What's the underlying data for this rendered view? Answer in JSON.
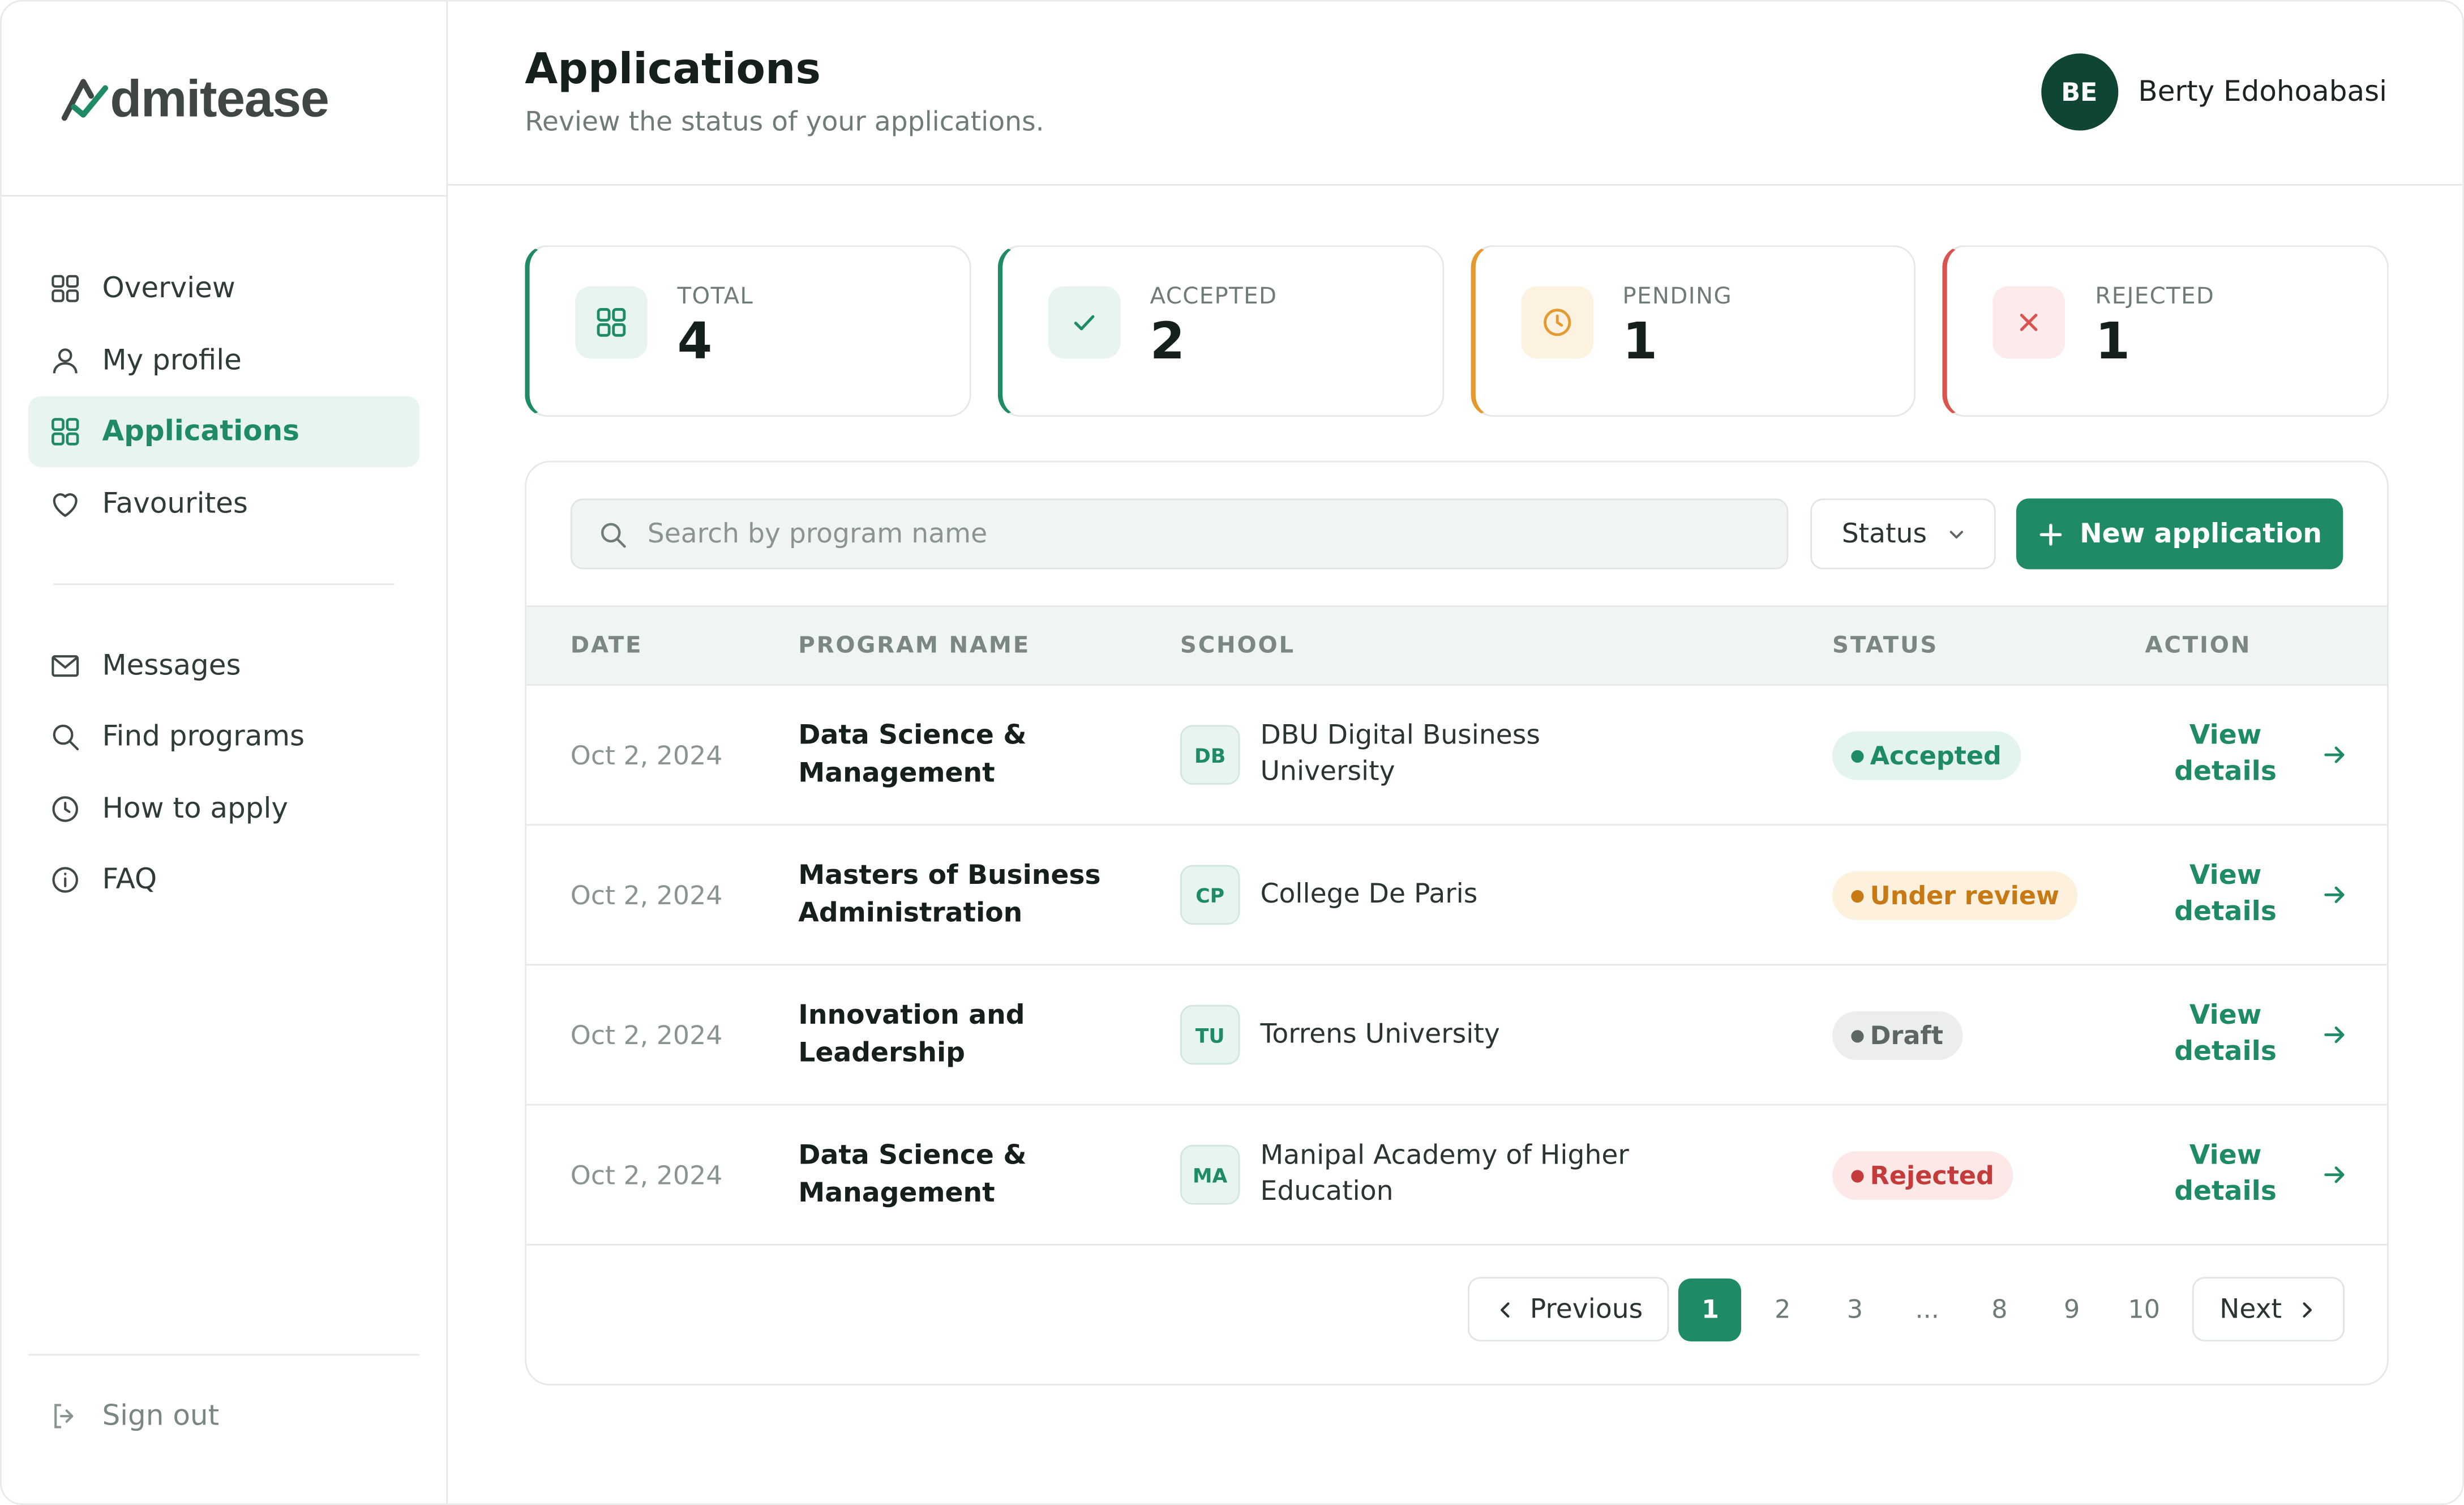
{
  "brand": {
    "logo_text": "dmitease",
    "colors": {
      "primary": "#1f8a66",
      "dark": "#0f4535",
      "pending": "#e59a2f",
      "rejected": "#d9534f"
    }
  },
  "sidebar": {
    "items": [
      {
        "label": "Overview",
        "icon": "grid-icon"
      },
      {
        "label": "My profile",
        "icon": "user-icon"
      },
      {
        "label": "Applications",
        "icon": "grid-icon",
        "active": true
      },
      {
        "label": "Favourites",
        "icon": "heart-icon"
      }
    ],
    "items2": [
      {
        "label": "Messages",
        "icon": "mail-icon"
      },
      {
        "label": "Find programs",
        "icon": "search-icon"
      },
      {
        "label": "How to apply",
        "icon": "clock-icon"
      },
      {
        "label": "FAQ",
        "icon": "info-icon"
      }
    ],
    "signout": "Sign out"
  },
  "header": {
    "title": "Applications",
    "subtitle": "Review the status of your applications.",
    "user_initials": "BE",
    "user_name": "Berty Edohoabasi"
  },
  "stats": [
    {
      "label": "TOTAL",
      "value": "4",
      "icon": "grid-icon"
    },
    {
      "label": "ACCEPTED",
      "value": "2",
      "icon": "check-icon"
    },
    {
      "label": "PENDING",
      "value": "1",
      "icon": "clock-icon"
    },
    {
      "label": "REJECTED",
      "value": "1",
      "icon": "x-icon"
    }
  ],
  "toolbar": {
    "search_placeholder": "Search by program name",
    "status_label": "Status",
    "new_label": "New application"
  },
  "table": {
    "headers": {
      "date": "DATE",
      "program": "PROGRAM NAME",
      "school": "SCHOOL",
      "status": "STATUS",
      "action": "ACTION"
    },
    "rows": [
      {
        "date": "Oct 2, 2024",
        "program": "Data Science & Management",
        "school_abbr": "DB",
        "school": "DBU Digital Business University",
        "status": "Accepted",
        "action": "View details"
      },
      {
        "date": "Oct 2, 2024",
        "program": "Masters of Business Administration",
        "school_abbr": "CP",
        "school": "College De Paris",
        "status": "Under review",
        "action": "View details"
      },
      {
        "date": "Oct 2, 2024",
        "program": "Innovation and Leadership",
        "school_abbr": "TU",
        "school": "Torrens University",
        "status": "Draft",
        "action": "View details"
      },
      {
        "date": "Oct 2, 2024",
        "program": "Data Science & Management",
        "school_abbr": "MA",
        "school": "Manipal Academy of Higher Education",
        "status": "Rejected",
        "action": "View details"
      }
    ]
  },
  "pagination": {
    "previous": "Previous",
    "next": "Next",
    "pages": [
      "1",
      "2",
      "3",
      "...",
      "8",
      "9",
      "10"
    ],
    "current": "1"
  }
}
